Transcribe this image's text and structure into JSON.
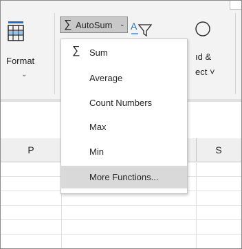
{
  "ribbon": {
    "format_label": "Format",
    "format_caret": "ˇ",
    "autosum_label": "AutoSum",
    "autosum_caret": "˅",
    "clipped_find_line1": "ıd &",
    "clipped_find_line2": "ect ˅"
  },
  "menu": {
    "items": [
      {
        "label": "Sum",
        "has_sigma": true
      },
      {
        "label": "Average"
      },
      {
        "label": "Count Numbers"
      },
      {
        "label": "Max"
      },
      {
        "label": "Min"
      },
      {
        "label": "More Functions...",
        "highlighted": true
      }
    ]
  },
  "grid": {
    "col_headers": [
      "P",
      "S"
    ]
  },
  "colors": {
    "ribbon_bg": "#f3f3f3",
    "autosum_pressed_bg": "#c8c8c8",
    "menu_hover_bg": "#d9d9d9",
    "header_bg": "#efefef"
  }
}
